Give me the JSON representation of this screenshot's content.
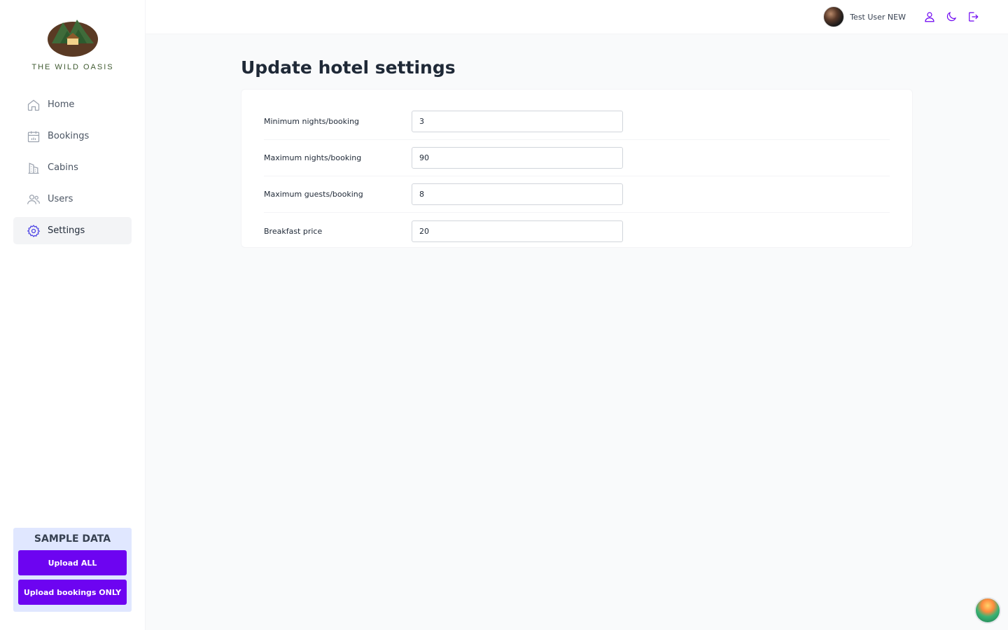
{
  "app": {
    "logo_text": "THE WILD OASIS"
  },
  "sidebar": {
    "items": [
      {
        "label": "Home",
        "icon": "home-icon",
        "active": false
      },
      {
        "label": "Bookings",
        "icon": "calendar-icon",
        "active": false
      },
      {
        "label": "Cabins",
        "icon": "building-icon",
        "active": false
      },
      {
        "label": "Users",
        "icon": "users-icon",
        "active": false
      },
      {
        "label": "Settings",
        "icon": "gear-icon",
        "active": true
      }
    ],
    "sample_data": {
      "title": "SAMPLE DATA",
      "upload_all_label": "Upload ALL",
      "upload_bookings_label": "Upload bookings ONLY"
    }
  },
  "header": {
    "user_name": "Test User NEW",
    "icons": [
      "user-icon",
      "moon-icon",
      "logout-icon"
    ]
  },
  "main": {
    "title": "Update hotel settings",
    "fields": [
      {
        "label": "Minimum nights/booking",
        "value": "3"
      },
      {
        "label": "Maximum nights/booking",
        "value": "90"
      },
      {
        "label": "Maximum guests/booking",
        "value": "8"
      },
      {
        "label": "Breakfast price",
        "value": "20"
      }
    ]
  },
  "colors": {
    "accent": "#6d04f1",
    "active_icon": "#4f46e5",
    "sample_bg": "#e0e7ff"
  }
}
